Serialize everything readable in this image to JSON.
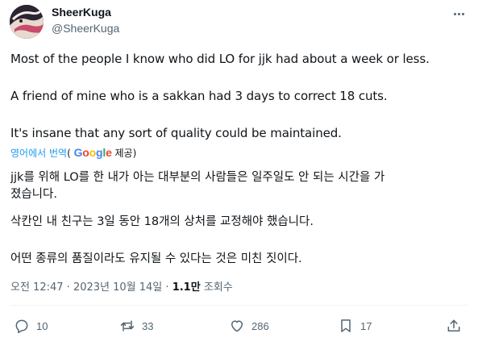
{
  "author": {
    "name": "SheerKuga",
    "handle": "@SheerKuga"
  },
  "tweet": {
    "lines": [
      "Most of the people I know who did LO for jjk had about a week or less.",
      "A friend of mine who is a sakkan had 3 days to correct 18 cuts.",
      "It's insane that any sort of quality could be maintained."
    ]
  },
  "translation": {
    "link_label": "영어에서 번역",
    "open_paren": "(",
    "google_letters": [
      "G",
      "o",
      "o",
      "g",
      "l",
      "e"
    ],
    "provided_label": "제공)",
    "lines": [
      "jjk를 위해 LO를 한 내가 아는 대부분의 사람들은 일주일도 안 되는 시간을 가",
      "졌습니다.",
      "삭칸인 내 친구는 3일 동안 18개의 상처를 교정해야 했습니다.",
      "어떤 종류의 품질이라도 유지될 수 있다는 것은 미친 짓이다."
    ]
  },
  "meta": {
    "time": "오전 12:47",
    "separator": "·",
    "date": "2023년 10월 14일",
    "views_count": "1.1만",
    "views_label": "조회수"
  },
  "actions": {
    "replies": "10",
    "retweets": "33",
    "likes": "286",
    "bookmarks": "17"
  },
  "colors": {
    "text": "#0f1419",
    "secondary": "#536471",
    "link": "#1d9bf0",
    "divider": "#eff3f4"
  }
}
